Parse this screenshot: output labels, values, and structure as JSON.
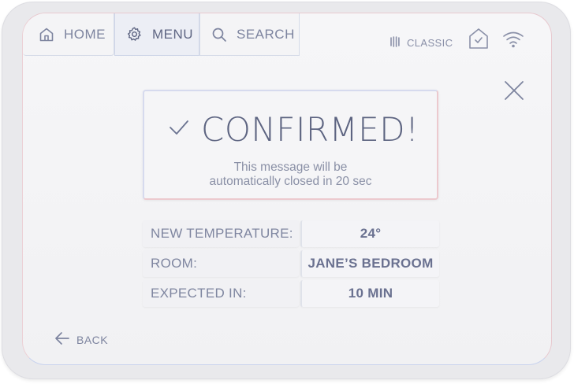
{
  "nav": {
    "tabs": [
      {
        "label": "HOME",
        "icon": "home-icon"
      },
      {
        "label": "MENU",
        "icon": "gear-icon"
      },
      {
        "label": "SEARCH",
        "icon": "search-icon"
      }
    ]
  },
  "status": {
    "mode_label": "CLASSIC",
    "mode_icon": "radiator-icon",
    "home_icon": "home-check-icon",
    "wifi_icon": "wifi-icon"
  },
  "confirmation": {
    "title": "CONFIRMED!",
    "message_line1": "This message will be",
    "message_line2": "automatically closed in 20 sec"
  },
  "details": [
    {
      "label": "NEW TEMPERATURE:",
      "value": "24°"
    },
    {
      "label": "ROOM:",
      "value": "JANE’S BEDROOM"
    },
    {
      "label": "EXPECTED IN:",
      "value": "10 MIN"
    }
  ],
  "back": {
    "label": "BACK"
  },
  "colors": {
    "text": "#7d849f",
    "title": "#5d6481",
    "screen_bg": "#f3f3f5",
    "accent_blue": "#d6daee",
    "accent_pink": "#ecc9ce"
  }
}
